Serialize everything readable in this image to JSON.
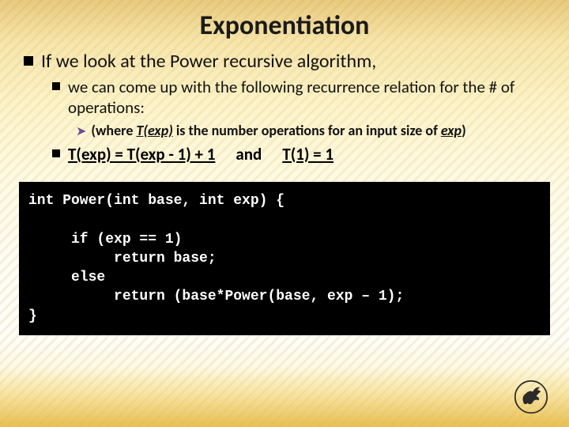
{
  "title": "Exponentiation",
  "bullets": {
    "l1": "If we look at the Power recursive algorithm,",
    "l2a": "we can come up with the following recurrence relation for the # of operations:",
    "l3_pre": "(where ",
    "l3_Texp": "T(exp)",
    "l3_mid": " is the number operations for an input size of ",
    "l3_exp": "exp",
    "l3_post": ")",
    "recur_left": "T(exp) = T(exp - 1) + 1",
    "recur_and": "and",
    "recur_right": "T(1) = 1"
  },
  "code": "int Power(int base, int exp) {\n\n     if (exp == 1)\n          return base;\n     else\n          return (base*Power(base, exp – 1);\n}",
  "logo_alt": "UCF Pegasus logo"
}
